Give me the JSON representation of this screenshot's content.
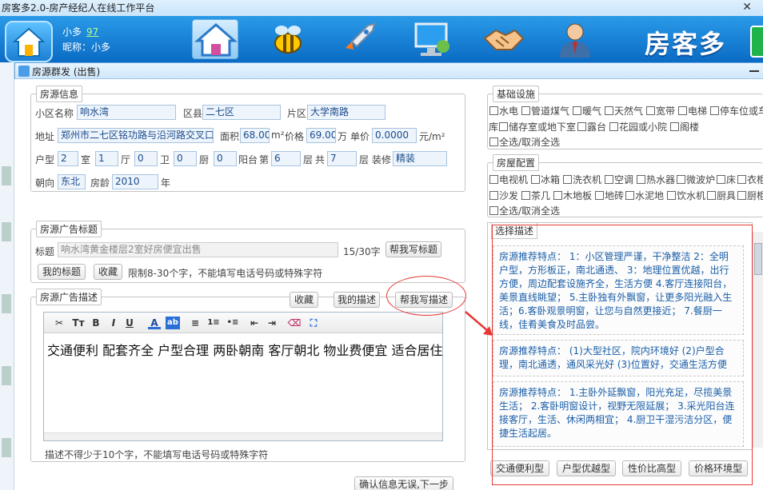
{
  "window": {
    "title": "房客多2.0-房产经纪人在线工作平台",
    "close": "✕"
  },
  "banner": {
    "user_name": "小多",
    "user_score": "97",
    "nickname": "昵称：小多",
    "brand": "房客多"
  },
  "dialog": {
    "title": "房源群发 (出售)"
  },
  "info": {
    "legend": "房源信息",
    "community_label": "小区名称",
    "community": "响水湾",
    "district_label": "区县",
    "district": "二七区",
    "area_label": "片区",
    "area": "大学南路",
    "address_label": "地址",
    "address": "郑州市二七区铭功路与沿河路交叉口",
    "size_label": "面积",
    "size": "68.00",
    "size_unit": "m²",
    "price_label": "价格",
    "price": "69.00",
    "price_unit": "万",
    "unit_label": "单价",
    "unit_price": "0.0000",
    "unit_price_unit": "元/m²",
    "layout_label": "户型",
    "rooms": "2",
    "rooms_unit": "室",
    "halls": "1",
    "halls_unit": "厅",
    "baths": "0",
    "baths_unit": "卫",
    "kitchens": "0",
    "kitchens_unit": "厨",
    "balconies": "0",
    "balconies_unit": "阳台",
    "floor_pre": "第",
    "floor": "6",
    "floor_unit": "层",
    "total_pre": "共",
    "total": "7",
    "total_unit": "层",
    "decor_label": "装修",
    "decor": "精装",
    "orient_label": "朝向",
    "orient": "东北",
    "age_label": "房龄",
    "age": "2010",
    "age_unit": "年"
  },
  "ad_title": {
    "legend": "房源广告标题",
    "label": "标题",
    "placeholder": "响水湾黄金楼层2室好房便宜出售",
    "count": "15/30字",
    "help_btn": "帮我写标题",
    "my_btn": "我的标题",
    "fav_btn": "收藏",
    "hint": "限制8-30个字，不能填写电话号码或特殊字符"
  },
  "ad_desc": {
    "legend": "房源广告描述",
    "fav_btn": "收藏",
    "my_btn": "我的描述",
    "help_btn": "帮我写描述",
    "content": "交通便利 配套齐全 户型合理 两卧朝南 客厅朝北 物业费便宜 适合居住",
    "hint": "描述不得少于10个字，不能填写电话号码或特殊字符",
    "toolbar": [
      "✂",
      "Tт",
      "B",
      "I",
      "U",
      "A",
      "ab",
      "≡",
      "1≡",
      "•≡",
      "⇤",
      "⇥",
      "⌫",
      "⛶"
    ]
  },
  "facilities": {
    "legend": "基础设施",
    "row1": [
      "水电",
      "管道煤气",
      "暖气",
      "天然气",
      "宽带",
      "电梯",
      "停车位或车"
    ],
    "row2_pre": "库",
    "row2": [
      "储存室或地下室",
      "露台",
      "花园或小院",
      "阁楼"
    ],
    "toggle_all": "全选/取消全选"
  },
  "equipment": {
    "legend": "房屋配置",
    "row1": [
      "电视机",
      "冰箱",
      "洗衣机",
      "空调",
      "热水器",
      "微波炉",
      "床",
      "衣柜"
    ],
    "row2": [
      "沙发",
      "茶几",
      "木地板",
      "地砖",
      "水泥地",
      "饮水机",
      "厨具",
      "厨柜"
    ],
    "toggle_all": "全选/取消全选"
  },
  "descriptions": {
    "legend": "选择描述",
    "items": [
      "房源推荐特点： 1：小区管理严谨，干净整洁 2：全明户型，方形板正，南北通透、 3：地理位置优越，出行方便，周边配套设施齐全，生活方便 4.客厅连接阳台，美景直线眺望； 5.主卧独有外飘窗，让更多阳光融入生活；6.客卧观景明窗，让您与自然更接近； 7.餐厨一线，佳肴美食及时品尝。",
      "房源推荐特点： (1)大型社区，院内环境好 (2)户型合理，南北通透，通风采光好 (3)位置好，交通生活方便",
      "房源推荐特点： 1.主卧外延飘窗，阳光充足，尽揽美景生活； 2.客卧明窗设计，视野无限延展； 3.采光阳台连接客厅，生活、休闲两相宜； 4.厨卫干湿污洁分区，便捷生活起居。"
    ],
    "tags": [
      "交通便利型",
      "户型优越型",
      "性价比高型",
      "价格环境型"
    ]
  },
  "next_btn": "确认信息无误,下一步"
}
